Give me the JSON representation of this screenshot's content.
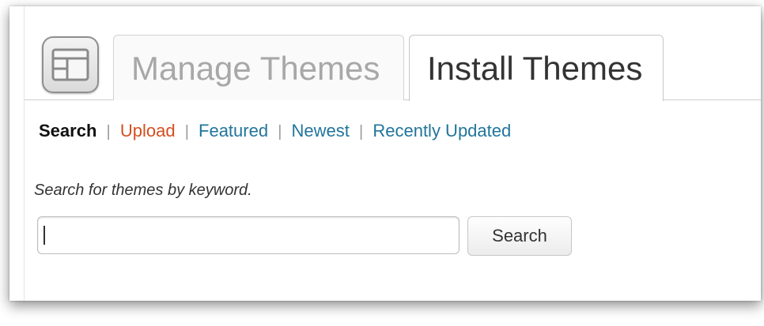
{
  "header": {
    "icon": "appearance-themes-icon",
    "tabs": [
      {
        "label": "Manage Themes",
        "active": false
      },
      {
        "label": "Install Themes",
        "active": true
      }
    ]
  },
  "subnav": {
    "separator": "|",
    "items": [
      {
        "label": "Search",
        "current": true
      },
      {
        "label": "Upload",
        "color": "#d54e21"
      },
      {
        "label": "Featured",
        "color": "#21759b"
      },
      {
        "label": "Newest",
        "color": "#21759b"
      },
      {
        "label": "Recently Updated",
        "color": "#21759b"
      }
    ]
  },
  "search": {
    "hint": "Search for themes by keyword.",
    "value": "",
    "button_label": "Search"
  }
}
